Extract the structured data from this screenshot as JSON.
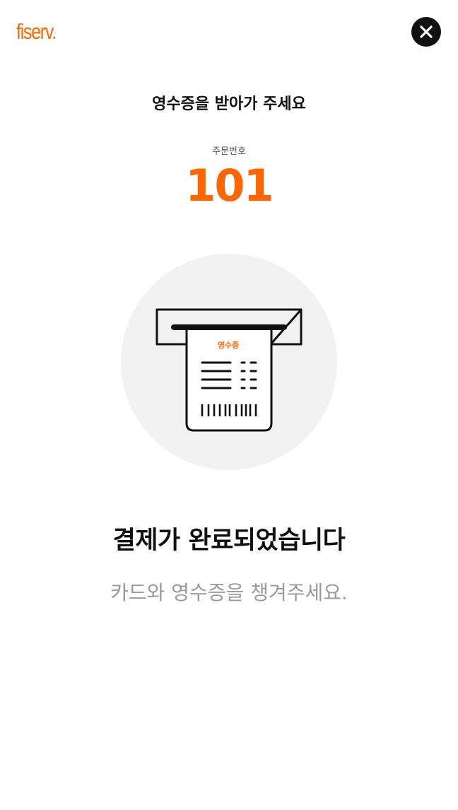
{
  "header": {
    "logo_text": "fiserv.",
    "close_icon": "close-icon"
  },
  "colors": {
    "brand_orange": "#ff6600",
    "dark": "#111111",
    "muted_text": "#9a9a9a",
    "illustration_bg": "#f2f2f2"
  },
  "instruction": "영수증을 받아가 주세요",
  "order": {
    "label": "주문번호",
    "number": "101"
  },
  "illustration": {
    "icon": "receipt-printer-icon",
    "receipt_label": "영수증"
  },
  "headline": "결제가 완료되었습니다",
  "subtext": "카드와 영수증을 챙겨주세요."
}
